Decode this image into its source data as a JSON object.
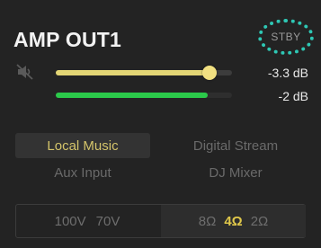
{
  "output": {
    "title": "AMP OUT1",
    "standby_label": "STBY",
    "mute_icon": "speaker-muted-icon"
  },
  "level": {
    "volume_db_label": "-3.3 dB",
    "volume_fraction": 0.87,
    "meter_db_label": "-2 dB",
    "meter_fraction": 0.86
  },
  "sources": [
    {
      "label": "Local Music",
      "active": true
    },
    {
      "label": "Digital Stream",
      "active": false
    },
    {
      "label": "Aux Input",
      "active": false
    },
    {
      "label": "DJ Mixer",
      "active": false
    }
  ],
  "voltage_options": [
    {
      "label": "100V",
      "active": false
    },
    {
      "label": "70V",
      "active": false
    }
  ],
  "impedance_options": [
    {
      "label": "8Ω",
      "active": false
    },
    {
      "label": "4Ω",
      "active": true
    },
    {
      "label": "2Ω",
      "active": false
    }
  ],
  "colors": {
    "accent_yellow": "#e3d675",
    "meter_green": "#2bc94a",
    "standby_teal": "#2ec7b4",
    "active_text": "#e0c84a"
  }
}
